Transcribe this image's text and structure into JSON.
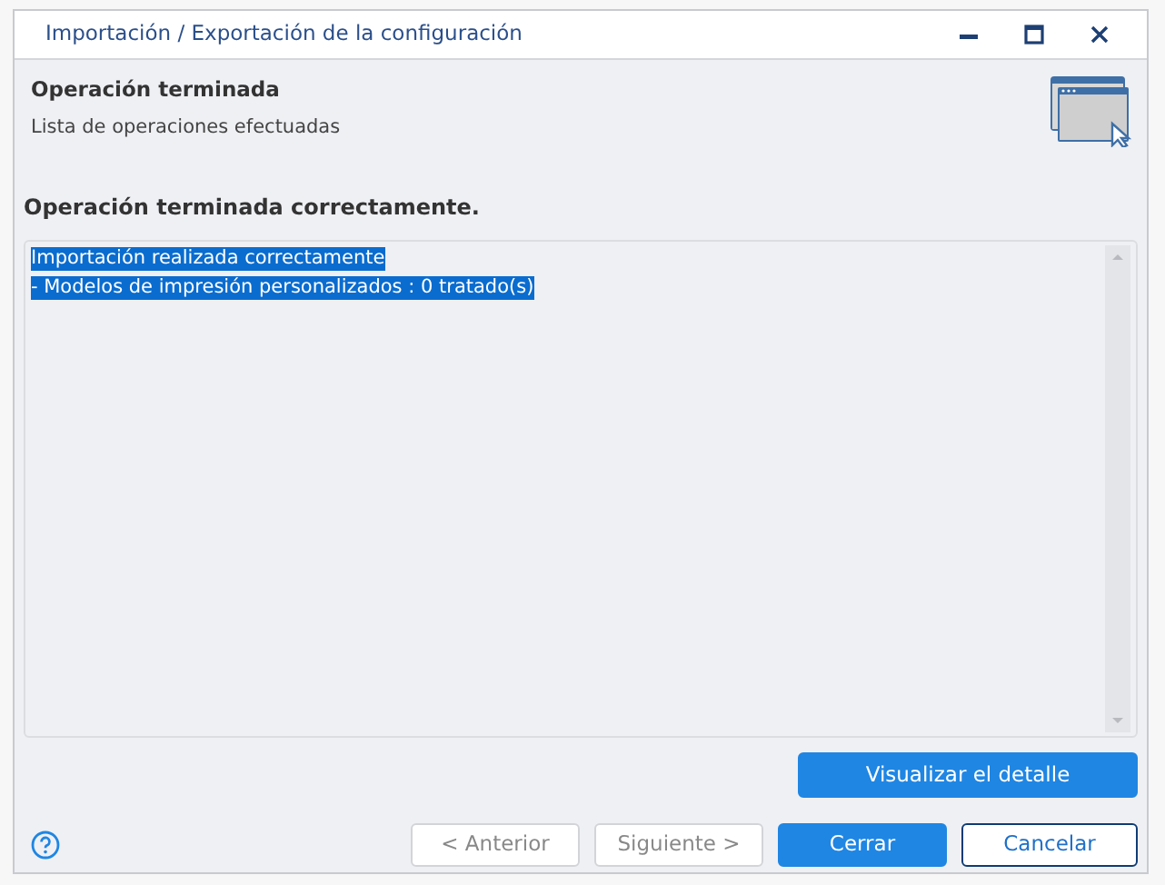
{
  "window": {
    "title": "Importación / Exportación de la configuración"
  },
  "header": {
    "title": "Operación terminada",
    "subtitle": "Lista de operaciones efectuadas"
  },
  "status": "Operación terminada correctamente.",
  "log": {
    "lines": [
      {
        "text": "Importación realizada correctamente",
        "selected": true
      },
      {
        "text": "- Modelos de impresión personalizados : 0 tratado(s)",
        "selected": true
      }
    ]
  },
  "detail_button": {
    "label": "Visualizar el detalle"
  },
  "buttons": [
    {
      "label": "< Anterior",
      "kind": "default",
      "disabled": true
    },
    {
      "label": "Siguiente >",
      "kind": "default",
      "disabled": true
    },
    {
      "label": "Cerrar",
      "kind": "primary",
      "disabled": false
    },
    {
      "label": "Cancelar",
      "kind": "focused",
      "disabled": false
    }
  ]
}
